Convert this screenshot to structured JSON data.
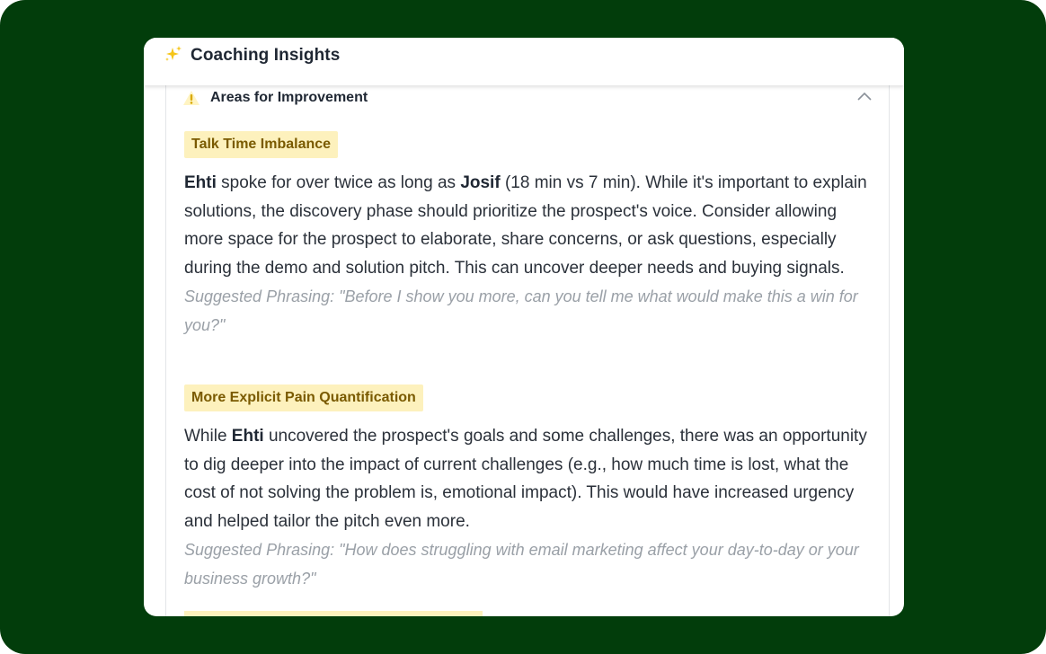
{
  "card": {
    "title": "Coaching Insights",
    "title_icon": "sparkle-icon"
  },
  "section": {
    "title": "Areas for Improvement",
    "icon": "warning-icon",
    "collapse_icon": "chevron-up-icon"
  },
  "items": [
    {
      "tag": "Talk Time Imbalance",
      "body": [
        {
          "t": "Ehti",
          "b": true
        },
        {
          "t": " spoke for over twice as long as ",
          "b": false
        },
        {
          "t": "Josif",
          "b": true
        },
        {
          "t": " (18 min vs 7 min). While it's important to explain solutions, the discovery phase should prioritize the prospect's voice. Consider allowing more space for the prospect to elaborate, share concerns, or ask questions, especially during the demo and solution pitch. This can uncover deeper needs and buying signals.",
          "b": false
        }
      ],
      "suggestion": "Suggested Phrasing: \"Before I show you more, can you tell me what would make this a win for you?\""
    },
    {
      "tag": "More Explicit Pain Quantification",
      "body": [
        {
          "t": "While ",
          "b": false
        },
        {
          "t": "Ehti",
          "b": true
        },
        {
          "t": " uncovered the prospect's goals and some challenges, there was an opportunity to dig deeper into the impact of current challenges (e.g., how much time is lost, what the cost of not solving the problem is, emotional impact). This would have increased urgency and helped tailor the pitch even more.",
          "b": false
        }
      ],
      "suggestion": "Suggested Phrasing: \"How does struggling with email marketing affect your day-to-day or your business growth?\""
    }
  ],
  "colors": {
    "frame_bg": "#023d0b",
    "tag_bg": "#fdf1bd",
    "tag_text": "#7a5a00",
    "warning": "#f2c200"
  }
}
